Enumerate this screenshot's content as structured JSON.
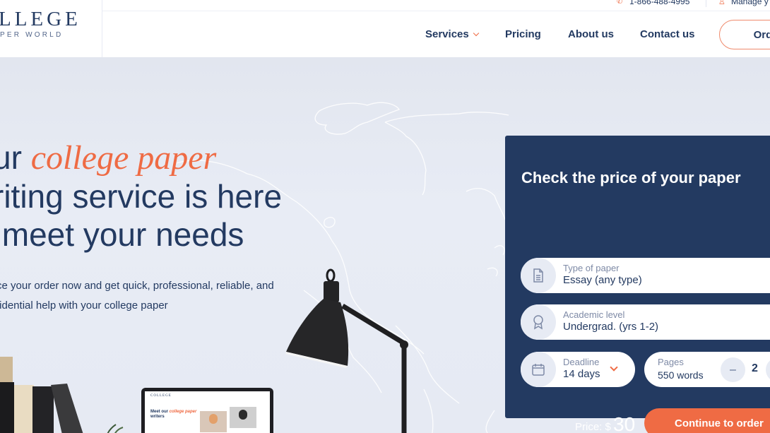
{
  "brand": {
    "logo_main": "LLEGE",
    "logo_sub": "PER WORLD"
  },
  "topbar": {
    "phone": "1-866-488-4995",
    "manage": "Manage y"
  },
  "nav": {
    "items": [
      {
        "label": "Services",
        "has_dropdown": true
      },
      {
        "label": "Pricing"
      },
      {
        "label": "About us"
      },
      {
        "label": "Contact us"
      }
    ],
    "order_label": "Order"
  },
  "hero": {
    "title_line1_prefix": "ur ",
    "title_line1_accent": "college paper",
    "title_line2": "riting service is here",
    "title_line3": " meet your needs",
    "subtitle_line1": "ce your order now and get quick, professional, reliable, and",
    "subtitle_line2": "fidential help with your college paper"
  },
  "price_card": {
    "title": "Check the price of your paper",
    "type_of_paper": {
      "label": "Type of paper",
      "value": "Essay (any type)"
    },
    "academic_level": {
      "label": "Academic level",
      "value": "Undergrad. (yrs 1-2)"
    },
    "deadline": {
      "label": "Deadline",
      "value": "14 days"
    },
    "pages": {
      "label": "Pages",
      "words": "550 words",
      "count": "2",
      "minus": "–",
      "plus": "+"
    },
    "price_label": "Price: $",
    "price_value": "30",
    "continue_label": "Continue to order"
  },
  "laptop_screen": {
    "logo": "COLLEGE",
    "heading_prefix": "Meet our ",
    "heading_accent": "college paper",
    "heading_suffix": " writers"
  },
  "colors": {
    "navy": "#233a61",
    "accent": "#ef6b44",
    "hero_bg": "#e6eaf3"
  }
}
